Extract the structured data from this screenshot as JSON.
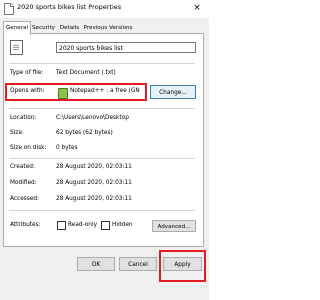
{
  "window": {
    "title": "2020 sports bikes list Properties",
    "close_glyph": "×"
  },
  "tabs": [
    {
      "label": "General",
      "active": true
    },
    {
      "label": "Security",
      "active": false
    },
    {
      "label": "Details",
      "active": false
    },
    {
      "label": "Previous Versions",
      "active": false
    }
  ],
  "general": {
    "file_name": "2020 sports bikes list",
    "file_icon": "text-document-icon",
    "type_label": "Type of file:",
    "type_value": "Text Document (.txt)",
    "opens_label": "Opens with:",
    "opens_value": "Notepad++ : a free (GN",
    "opens_icon": "notepad-plus-plus-icon",
    "change_label": "Change...",
    "location_label": "Location:",
    "location_value": "C:\\Users\\Lenovo\\Desktop",
    "size_label": "Size:",
    "size_value": "62 bytes (62 bytes)",
    "size_on_disk_label": "Size on disk:",
    "size_on_disk_value": "0 bytes",
    "created_label": "Created:",
    "created_value": "28 August 2020, 02:03:11",
    "modified_label": "Modified:",
    "modified_value": "28 August 2020, 02:03:11",
    "accessed_label": "Accessed:",
    "accessed_value": "28 August 2020, 02:03:11",
    "attributes_label": "Attributes:",
    "readonly_label": "Read-only",
    "readonly_checked": false,
    "hidden_label": "Hidden",
    "hidden_checked": false,
    "advanced_label": "Advanced..."
  },
  "footer": {
    "ok_label": "OK",
    "cancel_label": "Cancel",
    "apply_label": "Apply"
  },
  "highlight_color": "#e31b23"
}
